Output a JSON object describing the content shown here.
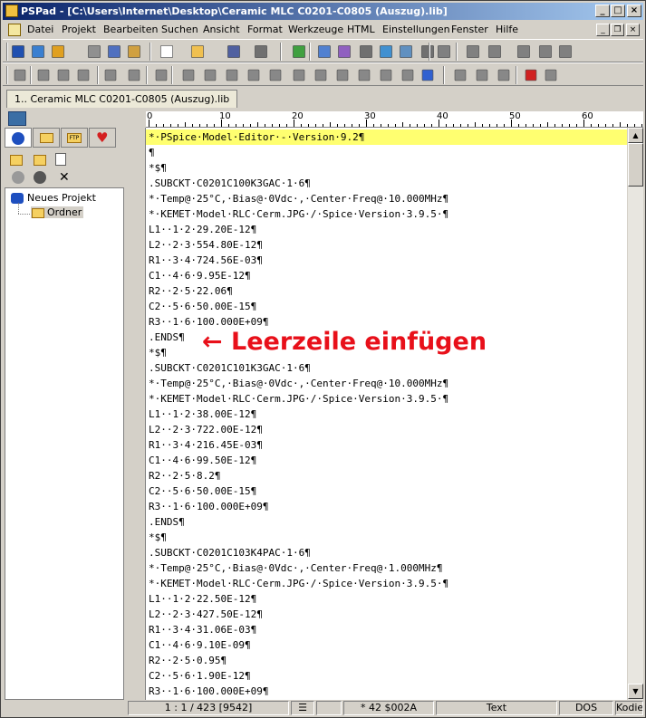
{
  "window": {
    "title": "PSPad - [C:\\Users\\Internet\\Desktop\\Ceramic MLC C0201-C0805 (Auszug).lib]"
  },
  "menu": [
    "Datei",
    "Projekt",
    "Bearbeiten",
    "Suchen",
    "Ansicht",
    "Format",
    "Werkzeuge",
    "HTML",
    "Einstellungen",
    "Fenster",
    "Hilfe"
  ],
  "toolbar_icons": [
    "save-all-icon",
    "open-project-icon",
    "new-project-icon",
    "close-icon",
    "log-icon",
    "settings-icon",
    "new-file-icon",
    "open-file-icon",
    "save-icon",
    "save-as-icon",
    "tree-icon",
    "find-icon",
    "replace-icon",
    "find-files-icon",
    "goto-icon",
    "print-preview-icon",
    "print-icon",
    "undo-icon",
    "redo-icon",
    "cut-icon",
    "copy-icon",
    "paste-icon",
    "clipboard-icon"
  ],
  "doc_tab": "1.. Ceramic MLC C0201-C0805 (Auszug).lib",
  "ruler": [
    "0",
    "10",
    "20",
    "30",
    "40",
    "50",
    "60"
  ],
  "tree": {
    "project": "Neues Projekt",
    "folder": "Ordner"
  },
  "code_lines": [
    "*·PSpice·Model·Editor·-·Version·9.2¶",
    "¶",
    "*$¶",
    ".SUBCKT·C0201C100K3GAC·1·6¶",
    "*·Temp@·25°C,·Bias@·0Vdc·,·Center·Freq@·10.000MHz¶",
    "*·KEMET·Model·RLC·Cerm.JPG·/·Spice·Version·3.9.5·¶",
    "L1··1·2·29.20E-12¶",
    "L2··2·3·554.80E-12¶",
    "R1··3·4·724.56E-03¶",
    "C1··4·6·9.95E-12¶",
    "R2··2·5·22.06¶",
    "C2··5·6·50.00E-15¶",
    "R3··1·6·100.000E+09¶",
    ".ENDS¶",
    "*$¶",
    ".SUBCKT·C0201C101K3GAC·1·6¶",
    "*·Temp@·25°C,·Bias@·0Vdc·,·Center·Freq@·10.000MHz¶",
    "*·KEMET·Model·RLC·Cerm.JPG·/·Spice·Version·3.9.5·¶",
    "L1··1·2·38.00E-12¶",
    "L2··2·3·722.00E-12¶",
    "R1··3·4·216.45E-03¶",
    "C1··4·6·99.50E-12¶",
    "R2··2·5·8.2¶",
    "C2··5·6·50.00E-15¶",
    "R3··1·6·100.000E+09¶",
    ".ENDS¶",
    "*$¶",
    ".SUBCKT·C0201C103K4PAC·1·6¶",
    "*·Temp@·25°C,·Bias@·0Vdc·,·Center·Freq@·1.000MHz¶",
    "*·KEMET·Model·RLC·Cerm.JPG·/·Spice·Version·3.9.5·¶",
    "L1··1·2·22.50E-12¶",
    "L2··2·3·427.50E-12¶",
    "R1··3·4·31.06E-03¶",
    "C1··4·6·9.10E-09¶",
    "R2··2·5·0.95¶",
    "C2··5·6·1.90E-12¶",
    "R3··1·6·100.000E+09¶"
  ],
  "annotation": {
    "text": "Leerzeile einfügen",
    "arrow": "←",
    "color": "#e8101a"
  },
  "status": {
    "position": "1 : 1 / 423  [9542]",
    "char": "*   42  $002A",
    "mode": "Text",
    "lineend": "DOS",
    "encoding": "Kodier"
  },
  "colors": {
    "title_start": "#0a246a",
    "title_end": "#a6caf0",
    "highlight_line": "#ffff70"
  }
}
